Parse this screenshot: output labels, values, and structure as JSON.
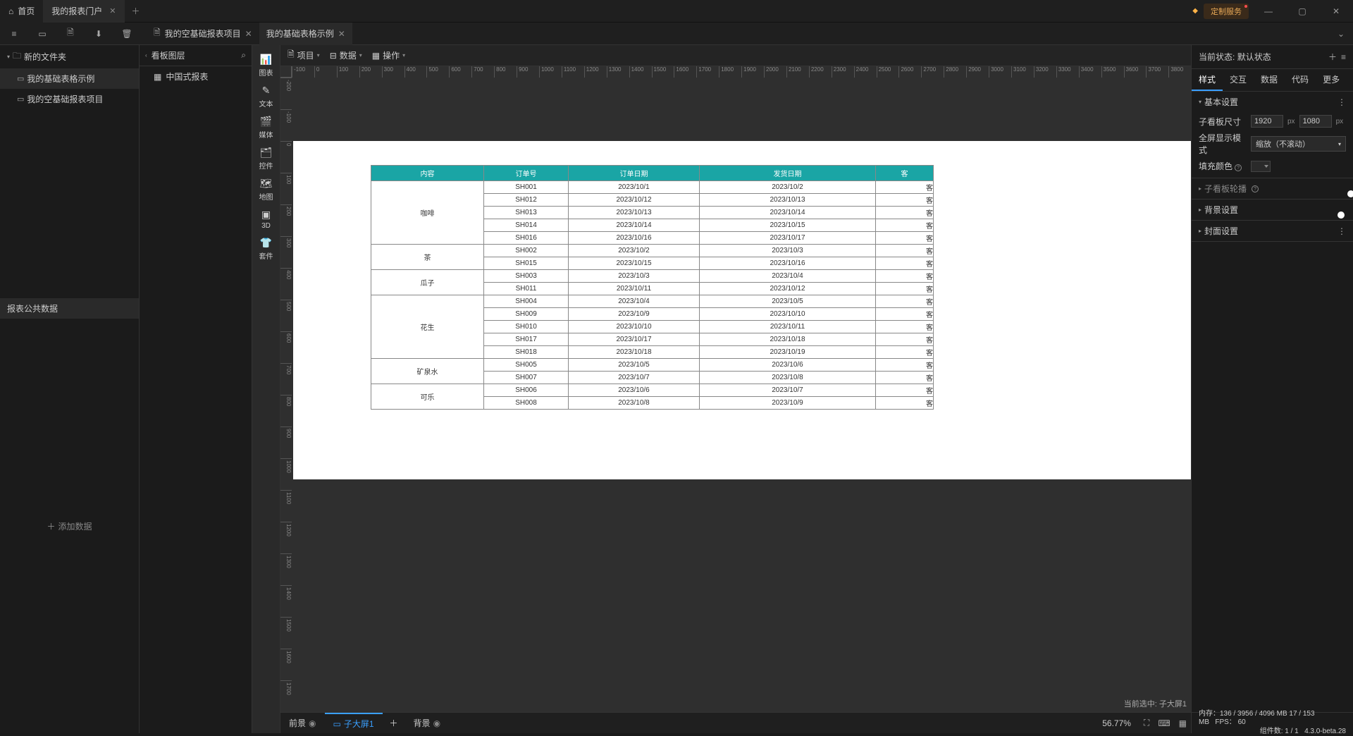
{
  "titlebar": {
    "home": "首页",
    "tab": "我的报表门户",
    "custom_service": "定制服务"
  },
  "toolbar": {
    "file_tab1": "我的空基础报表项目",
    "file_tab2": "我的基础表格示例"
  },
  "menubar": {
    "project": "项目",
    "data": "数据",
    "operation": "操作"
  },
  "sidebar": {
    "folder": "新的文件夹",
    "item1": "我的基础表格示例",
    "item2": "我的空基础报表项目",
    "pubdata": "报表公共数据",
    "adddata": "添加数据"
  },
  "layers": {
    "title": "看板图层",
    "item": "中国式报表"
  },
  "palette": {
    "chart": "图表",
    "text": "文本",
    "media": "媒体",
    "control": "控件",
    "map": "地图",
    "threeD": "3D",
    "suite": "套件"
  },
  "canvas": {
    "current_sel_label": "当前选中:",
    "current_sel": "子大屏1"
  },
  "bottom": {
    "fore": "前景",
    "tab1": "子大屏1",
    "back": "背景",
    "zoom": "56.77%"
  },
  "props": {
    "state_label": "当前状态:",
    "state": "默认状态",
    "tabs": {
      "style": "样式",
      "interact": "交互",
      "data": "数据",
      "code": "代码",
      "more": "更多"
    },
    "basic": "基本设置",
    "size_label": "子看板尺寸",
    "w": "1920",
    "h": "1080",
    "px": "px",
    "display_label": "全屏显示模式",
    "display_val": "缩放（不滚动）",
    "fill_label": "填充颜色",
    "carousel": "子看板轮播",
    "bg": "背景设置",
    "cover": "封面设置"
  },
  "status": {
    "mem": "内存：136 / 3956 / 4096 MB  17 / 153 MB",
    "fps": "FPS： 60",
    "comp": "组件数: 1 / 1",
    "ver": "4.3.0-beta.28"
  },
  "table": {
    "headers": {
      "c1": "内容",
      "c2": "订单号",
      "c3": "订单日期",
      "c4": "发货日期",
      "c5": "客"
    },
    "groups": [
      {
        "name": "咖啡",
        "rows": [
          {
            "o": "SH001",
            "od": "2023/10/1",
            "sd": "2023/10/2",
            "r": "客"
          },
          {
            "o": "SH012",
            "od": "2023/10/12",
            "sd": "2023/10/13",
            "r": "客"
          },
          {
            "o": "SH013",
            "od": "2023/10/13",
            "sd": "2023/10/14",
            "r": "客"
          },
          {
            "o": "SH014",
            "od": "2023/10/14",
            "sd": "2023/10/15",
            "r": "客"
          },
          {
            "o": "SH016",
            "od": "2023/10/16",
            "sd": "2023/10/17",
            "r": "客"
          }
        ]
      },
      {
        "name": "茶",
        "rows": [
          {
            "o": "SH002",
            "od": "2023/10/2",
            "sd": "2023/10/3",
            "r": "客"
          },
          {
            "o": "SH015",
            "od": "2023/10/15",
            "sd": "2023/10/16",
            "r": "客"
          }
        ]
      },
      {
        "name": "瓜子",
        "rows": [
          {
            "o": "SH003",
            "od": "2023/10/3",
            "sd": "2023/10/4",
            "r": "客"
          },
          {
            "o": "SH011",
            "od": "2023/10/11",
            "sd": "2023/10/12",
            "r": "客"
          }
        ]
      },
      {
        "name": "花生",
        "rows": [
          {
            "o": "SH004",
            "od": "2023/10/4",
            "sd": "2023/10/5",
            "r": "客"
          },
          {
            "o": "SH009",
            "od": "2023/10/9",
            "sd": "2023/10/10",
            "r": "客"
          },
          {
            "o": "SH010",
            "od": "2023/10/10",
            "sd": "2023/10/11",
            "r": "客"
          },
          {
            "o": "SH017",
            "od": "2023/10/17",
            "sd": "2023/10/18",
            "r": "客"
          },
          {
            "o": "SH018",
            "od": "2023/10/18",
            "sd": "2023/10/19",
            "r": "客"
          }
        ]
      },
      {
        "name": "矿泉水",
        "rows": [
          {
            "o": "SH005",
            "od": "2023/10/5",
            "sd": "2023/10/6",
            "r": "客"
          },
          {
            "o": "SH007",
            "od": "2023/10/7",
            "sd": "2023/10/8",
            "r": "客"
          }
        ]
      },
      {
        "name": "可乐",
        "rows": [
          {
            "o": "SH006",
            "od": "2023/10/6",
            "sd": "2023/10/7",
            "r": "客"
          },
          {
            "o": "SH008",
            "od": "2023/10/8",
            "sd": "2023/10/9",
            "r": "客"
          }
        ]
      }
    ]
  }
}
